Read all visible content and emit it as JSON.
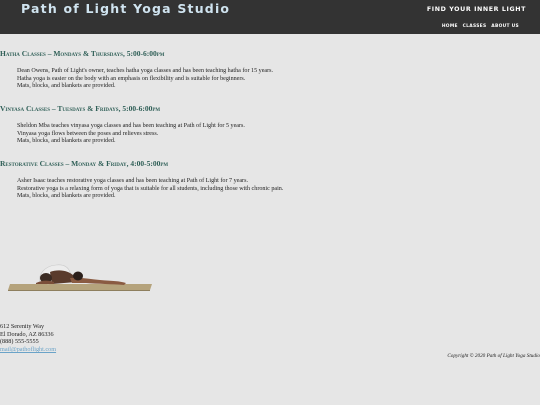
{
  "header": {
    "site_title": "Path of Light Yoga Studio",
    "tagline": "FIND YOUR INNER LIGHT",
    "nav": [
      "HOME",
      "CLASSES",
      "ABOUT US"
    ]
  },
  "classes": [
    {
      "heading": "Hatha Classes – Mondays & Thursdays, 5:00-6:00pm",
      "lines": [
        "Dean Owens, Path of Light's owner, teaches hatha yoga classes and has been teaching hatha for 15 years.",
        "Hatha yoga is easier on the body with an emphasis on flexibility and is suitable for beginners.",
        "Mats, blocks, and blankets are provided."
      ]
    },
    {
      "heading": "Vinyasa Classes – Tuesdays & Fridays, 5:00-6:00pm",
      "lines": [
        "Sheldon Mba teaches vinyasa yoga classes and has been teaching at Path of Light for 5 years.",
        "Vinyasa yoga flows between the poses and relieves stress.",
        "Mats, blocks, and blankets are provided."
      ]
    },
    {
      "heading": "Restorative Classes – Monday & Friday, 4:00-5:00pm",
      "lines": [
        "Asher Isaac teaches restorative yoga classes and has been teaching at Path of Light for 7 years.",
        "Restorative yoga is a relaxing form of yoga that is suitable for all students, including those with chronic pain.",
        "Mats, blocks, and blankets are provided."
      ]
    }
  ],
  "footer": {
    "address_lines": [
      "612 Serenity Way",
      "El Dorado, AZ 86336",
      "(888) 555-5555"
    ],
    "email": "mail@pathoflight.com",
    "copyright": "Copyright © 2020 Path of Light Yoga Studio"
  },
  "colors": {
    "header_bg": "#333333",
    "title": "#cfe3ef",
    "heading": "#2f5f57",
    "link": "#6aa3c8",
    "page_bg": "#e6e6e6"
  },
  "image": {
    "icon": "yoga-child-pose-icon"
  }
}
